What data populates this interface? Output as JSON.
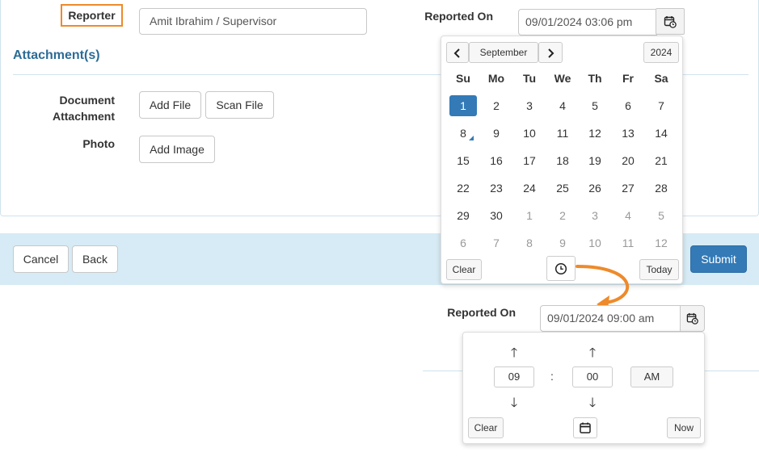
{
  "form": {
    "reporter_label": "Reporter",
    "reporter_value": "Amit Ibrahim / Supervisor",
    "reported_on_label": "Reported On",
    "reported_on_value": "09/01/2024 03:06 pm",
    "attachments_title": "Attachment(s)",
    "document_label_line1": "Document",
    "document_label_line2": "Attachment",
    "add_file": "Add File",
    "scan_file": "Scan File",
    "photo_label": "Photo",
    "add_image": "Add Image"
  },
  "footer": {
    "cancel": "Cancel",
    "back": "Back",
    "submit": "Submit"
  },
  "calendar": {
    "month": "September",
    "year": "2024",
    "weekdays": [
      "Su",
      "Mo",
      "Tu",
      "We",
      "Th",
      "Fr",
      "Sa"
    ],
    "weeks": [
      [
        "1",
        "2",
        "3",
        "4",
        "5",
        "6",
        "7"
      ],
      [
        "8",
        "9",
        "10",
        "11",
        "12",
        "13",
        "14"
      ],
      [
        "15",
        "16",
        "17",
        "18",
        "19",
        "20",
        "21"
      ],
      [
        "22",
        "23",
        "24",
        "25",
        "26",
        "27",
        "28"
      ],
      [
        "29",
        "30",
        "1",
        "2",
        "3",
        "4",
        "5"
      ],
      [
        "6",
        "7",
        "8",
        "9",
        "10",
        "11",
        "12"
      ]
    ],
    "selected_day": "1",
    "clear": "Clear",
    "today": "Today"
  },
  "time_section": {
    "reported_on_label": "Reported On",
    "value": "09/01/2024 09:00 am",
    "hour": "09",
    "separator": ":",
    "minute": "00",
    "period": "AM",
    "clear": "Clear",
    "now": "Now"
  },
  "colors": {
    "highlight": "#ee8a2b",
    "primary": "#337ab7",
    "section_title": "#2b6c96",
    "footer_bg": "#d6ebf5"
  }
}
